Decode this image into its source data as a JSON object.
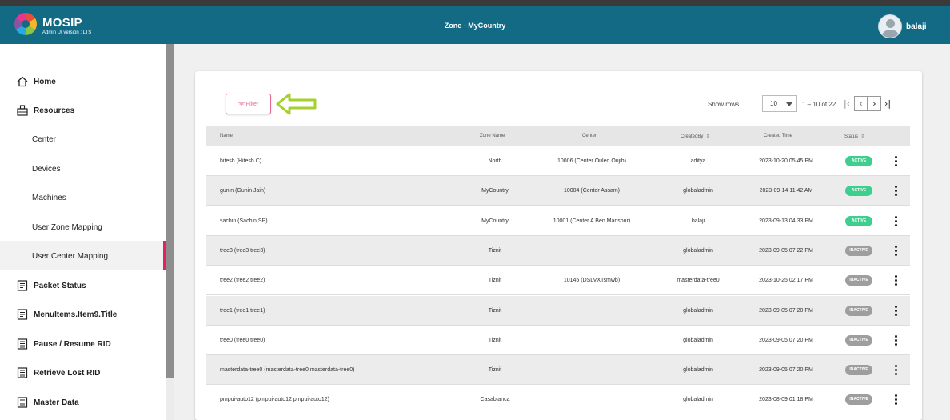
{
  "header": {
    "brand": "MOSIP",
    "brand_sub": "Admin UI version : LTS",
    "title": "Zone - MyCountry",
    "username": "balaji"
  },
  "sidebar": {
    "items": [
      {
        "label": "Home",
        "icon": "home-icon"
      },
      {
        "label": "Resources",
        "icon": "resources-icon"
      },
      {
        "label": "Center"
      },
      {
        "label": "Devices"
      },
      {
        "label": "Machines"
      },
      {
        "label": "User Zone Mapping"
      },
      {
        "label": "User Center Mapping",
        "active": true
      },
      {
        "label": "Packet Status",
        "icon": "packet-status-icon"
      },
      {
        "label": "MenuItems.Item9.Title",
        "icon": "menu-item-icon"
      },
      {
        "label": "Pause / Resume RID",
        "icon": "pause-resume-icon"
      },
      {
        "label": "Retrieve Lost RID",
        "icon": "retrieve-rid-icon"
      },
      {
        "label": "Master Data",
        "icon": "master-data-icon"
      }
    ]
  },
  "toolbar": {
    "filter_label": "Filter",
    "show_rows_label": "Show rows",
    "rows_value": "10",
    "range_label": "1 – 10 of 22"
  },
  "table": {
    "headers": [
      "Name",
      "Zone Name",
      "Center",
      "CreatedBy",
      "Created Time",
      "Status"
    ],
    "rows": [
      {
        "name": "hitesh (Hitesh C)",
        "zone": "North",
        "center": "10006 (Center Ouled Oujih)",
        "created_by": "aditya",
        "created_time": "2023-10-20 05:45 PM",
        "status": "ACTIVE"
      },
      {
        "name": "gunin (Gunin Jain)",
        "zone": "MyCountry",
        "center": "10004 (Center Assam)",
        "created_by": "globaladmin",
        "created_time": "2023-09-14 11:42 AM",
        "status": "ACTIVE"
      },
      {
        "name": "sachin (Sachin SP)",
        "zone": "MyCountry",
        "center": "10001 (Center A Ben Mansour)",
        "created_by": "balaji",
        "created_time": "2023-09-13 04:33 PM",
        "status": "ACTIVE"
      },
      {
        "name": "tree3 (tree3 tree3)",
        "zone": "Tiznit",
        "center": "",
        "created_by": "globaladmin",
        "created_time": "2023-09-05 07:22 PM",
        "status": "INACTIVE"
      },
      {
        "name": "tree2 (tree2 tree2)",
        "zone": "Tiznit",
        "center": "10145 (DSLVXTsmwb)",
        "created_by": "masterdata-tree0",
        "created_time": "2023-10-25 02:17 PM",
        "status": "INACTIVE"
      },
      {
        "name": "tree1 (tree1 tree1)",
        "zone": "Tiznit",
        "center": "",
        "created_by": "globaladmin",
        "created_time": "2023-09-05 07:20 PM",
        "status": "INACTIVE"
      },
      {
        "name": "tree0 (tree0 tree0)",
        "zone": "Tiznit",
        "center": "",
        "created_by": "globaladmin",
        "created_time": "2023-09-05 07:20 PM",
        "status": "INACTIVE"
      },
      {
        "name": "masterdata-tree0 (masterdata-tree0 masterdata-tree0)",
        "zone": "Tiznit",
        "center": "",
        "created_by": "globaladmin",
        "created_time": "2023-09-05 07:20 PM",
        "status": "INACTIVE"
      },
      {
        "name": "pmpui-auto12 (pmpui-auto12 pmpui-auto12)",
        "zone": "Casablanca",
        "center": "",
        "created_by": "globaladmin",
        "created_time": "2023-08-09 01:18 PM",
        "status": "INACTIVE"
      }
    ]
  },
  "colors": {
    "header_bg": "#126a84",
    "accent": "#e91e63",
    "active_badge": "#3ecf8e",
    "inactive_badge": "#9e9e9e",
    "arrow": "#a6d12a"
  }
}
